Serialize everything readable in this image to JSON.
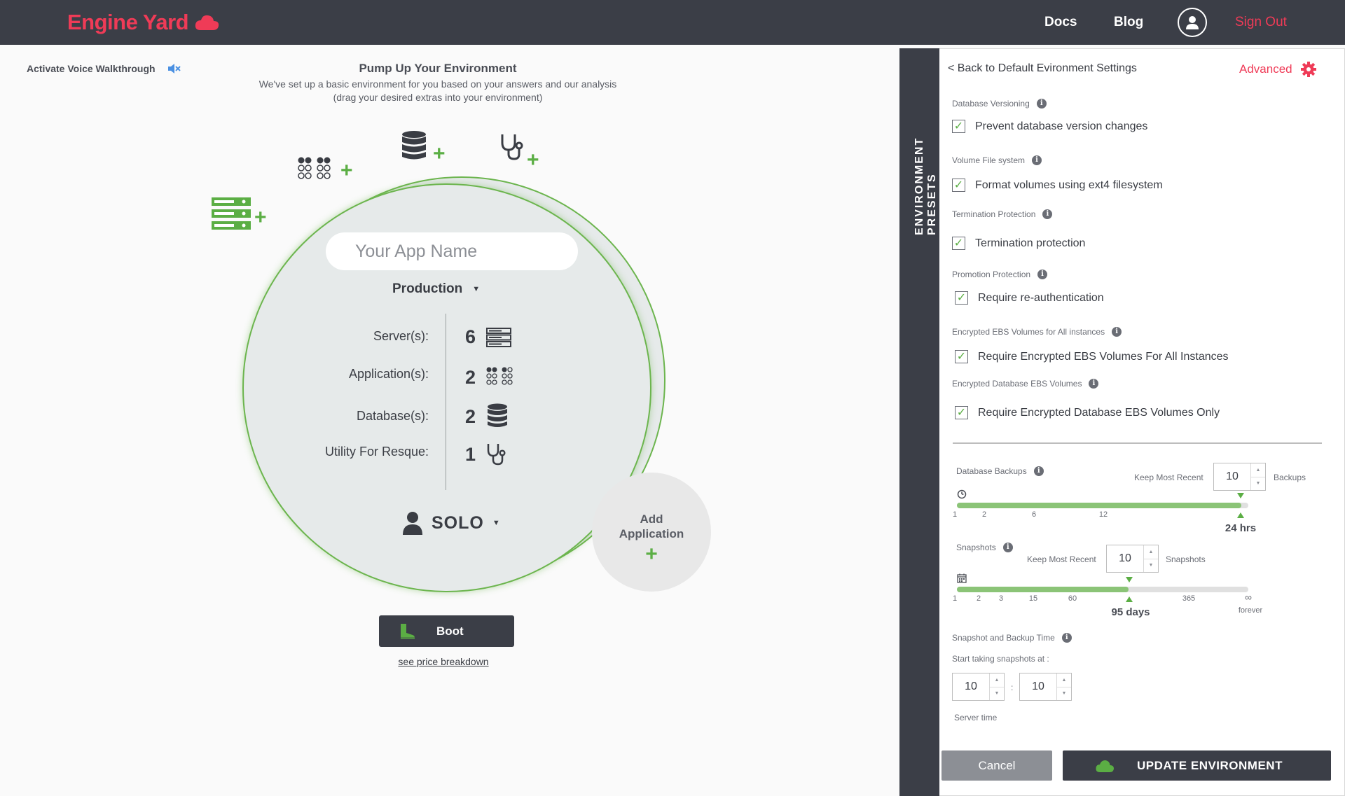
{
  "header": {
    "logo_text": "Engine Yard",
    "nav": {
      "docs": "Docs",
      "blog": "Blog",
      "sign_out": "Sign Out"
    }
  },
  "walkthrough": {
    "label": "Activate Voice Walkthrough"
  },
  "intro": {
    "title": "Pump Up Your Environment",
    "subtitle_line1": "We've set up a basic environment for you based on your answers and our analysis",
    "subtitle_line2": "(drag your desired extras into your environment)"
  },
  "environment": {
    "app_name_placeholder": "Your App Name",
    "app_name_value": "",
    "env_type": "Production",
    "resources": [
      {
        "label": "Server(s):",
        "count": "6",
        "icon": "server-icon"
      },
      {
        "label": "Application(s):",
        "count": "2",
        "icon": "application-icon"
      },
      {
        "label": "Database(s):",
        "count": "2",
        "icon": "database-icon"
      },
      {
        "label": "Utility For Resque:",
        "count": "1",
        "icon": "stethoscope-icon"
      }
    ],
    "plan": "SOLO"
  },
  "add_application": {
    "label_line1": "Add",
    "label_line2": "Application",
    "plus": "+"
  },
  "boot": {
    "label": "Boot",
    "price_link": "see price breakdown"
  },
  "panel": {
    "tab_label": "ENVIRONMENT PRESETS",
    "back_link": "< Back to Default Evironment Settings",
    "advanced": "Advanced",
    "sections": {
      "db_versioning": {
        "label": "Database Versioning",
        "option": "Prevent database version changes",
        "checked": true
      },
      "volume_fs": {
        "label": "Volume File system",
        "option": "Format volumes using ext4 filesystem",
        "checked": true
      },
      "termination": {
        "label": "Termination Protection",
        "option": "Termination protection",
        "checked": true
      },
      "promotion": {
        "label": "Promotion Protection",
        "option": "Require re-authentication",
        "checked": true
      },
      "ebs_all": {
        "label": "Encrypted EBS Volumes for All instances",
        "option": "Require Encrypted EBS Volumes For All Instances",
        "checked": true
      },
      "ebs_db": {
        "label": "Encrypted Database EBS Volumes",
        "option": "Require Encrypted Database EBS Volumes Only",
        "checked": true
      }
    },
    "db_backups": {
      "label": "Database Backups",
      "keep_label": "Keep Most Recent",
      "keep_value": "10",
      "unit": "Backups",
      "ticks": [
        "1",
        "2",
        "6",
        "12"
      ],
      "value": "24 hrs",
      "fill_fraction": 1.0
    },
    "snapshots": {
      "label": "Snapshots",
      "keep_label": "Keep Most Recent",
      "keep_value": "10",
      "unit": "Snapshots",
      "ticks": [
        "1",
        "2",
        "3",
        "15",
        "60",
        "365"
      ],
      "forever_label": "forever",
      "value": "95 days",
      "fill_fraction": 0.59
    },
    "schedule": {
      "label": "Snapshot and Backup Time",
      "start_label": "Start taking snapshots at :",
      "hour": "10",
      "minute": "10",
      "separator": ":",
      "note": "Server time"
    },
    "cancel": "Cancel",
    "update": "UPDATE ENVIRONMENT"
  },
  "colors": {
    "brand": "#ef3b57",
    "accent_green": "#5bae44",
    "dark": "#3b3e47"
  }
}
